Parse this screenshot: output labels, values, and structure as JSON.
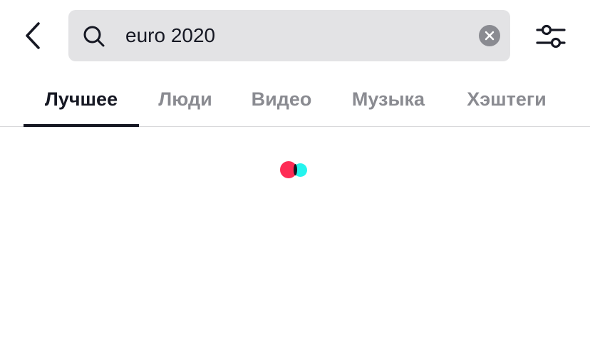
{
  "header": {
    "back_icon": "chevron-left-icon",
    "search": {
      "icon": "search-icon",
      "value": "euro 2020",
      "clear_icon": "close-icon"
    },
    "filter_icon": "sliders-icon"
  },
  "tabs": [
    {
      "label": "Лучшее",
      "active": true
    },
    {
      "label": "Люди",
      "active": false
    },
    {
      "label": "Видео",
      "active": false
    },
    {
      "label": "Музыка",
      "active": false
    },
    {
      "label": "Хэштеги",
      "active": false
    }
  ],
  "colors": {
    "text_primary": "#161823",
    "text_secondary": "#8a8b91",
    "search_bg": "#e3e3e5",
    "loader_red": "#fe2c55",
    "loader_cyan": "#25f4ee"
  }
}
